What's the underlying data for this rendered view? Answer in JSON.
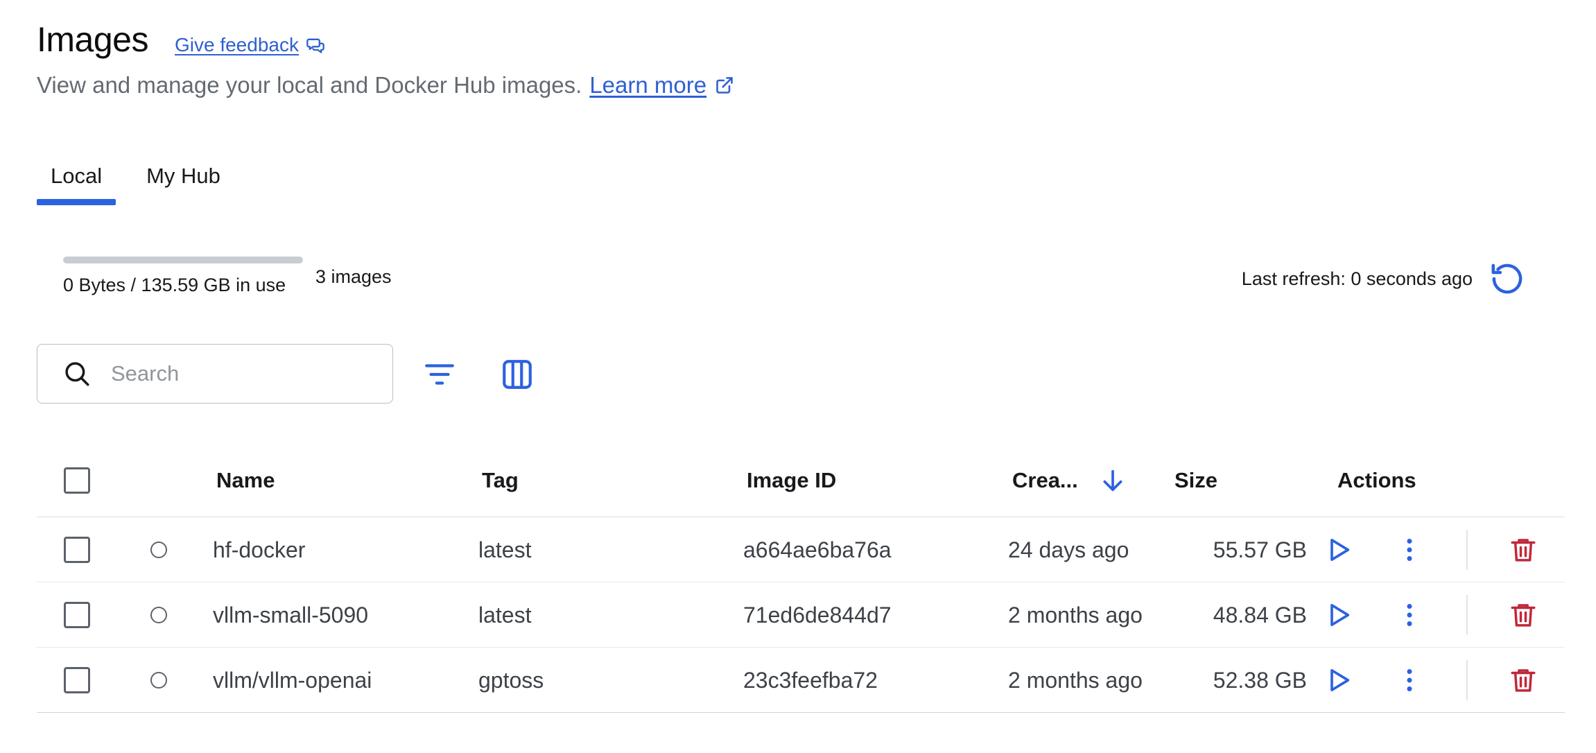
{
  "header": {
    "title": "Images",
    "feedback_label": "Give feedback",
    "subtitle": "View and manage your local and Docker Hub images.",
    "learn_more_label": "Learn more"
  },
  "tabs": [
    {
      "label": "Local",
      "active": true
    },
    {
      "label": "My Hub",
      "active": false
    }
  ],
  "usage": {
    "text": "0 Bytes / 135.59 GB in use",
    "fraction": 0,
    "image_count": "3 images"
  },
  "refresh": {
    "text": "Last refresh: 0 seconds ago"
  },
  "search": {
    "placeholder": "Search",
    "value": ""
  },
  "table": {
    "columns": {
      "name": "Name",
      "tag": "Tag",
      "image_id": "Image ID",
      "created": "Crea...",
      "size": "Size",
      "actions": "Actions"
    },
    "sort": {
      "column": "created",
      "direction": "descending"
    },
    "rows": [
      {
        "name": "hf-docker",
        "tag": "latest",
        "image_id": "a664ae6ba76a",
        "created": "24 days ago",
        "size": "55.57 GB"
      },
      {
        "name": "vllm-small-5090",
        "tag": "latest",
        "image_id": "71ed6de844d7",
        "created": "2 months ago",
        "size": "48.84 GB"
      },
      {
        "name": "vllm/vllm-openai",
        "tag": "gptoss",
        "image_id": "23c3feefba72",
        "created": "2 months ago",
        "size": "52.38 GB"
      }
    ]
  },
  "colors": {
    "accent": "#2c61e0",
    "link": "#2f5fd1",
    "danger": "#c0283a",
    "text_secondary": "#646a73"
  },
  "icons": {
    "feedback": "feedback-icon",
    "external_link": "external-link-icon",
    "refresh": "refresh-icon",
    "search": "search-icon",
    "filter": "filter-icon",
    "columns": "columns-icon",
    "sort": "arrow-down-icon",
    "run": "play-icon",
    "more": "more-vertical-icon",
    "delete": "trash-icon"
  }
}
